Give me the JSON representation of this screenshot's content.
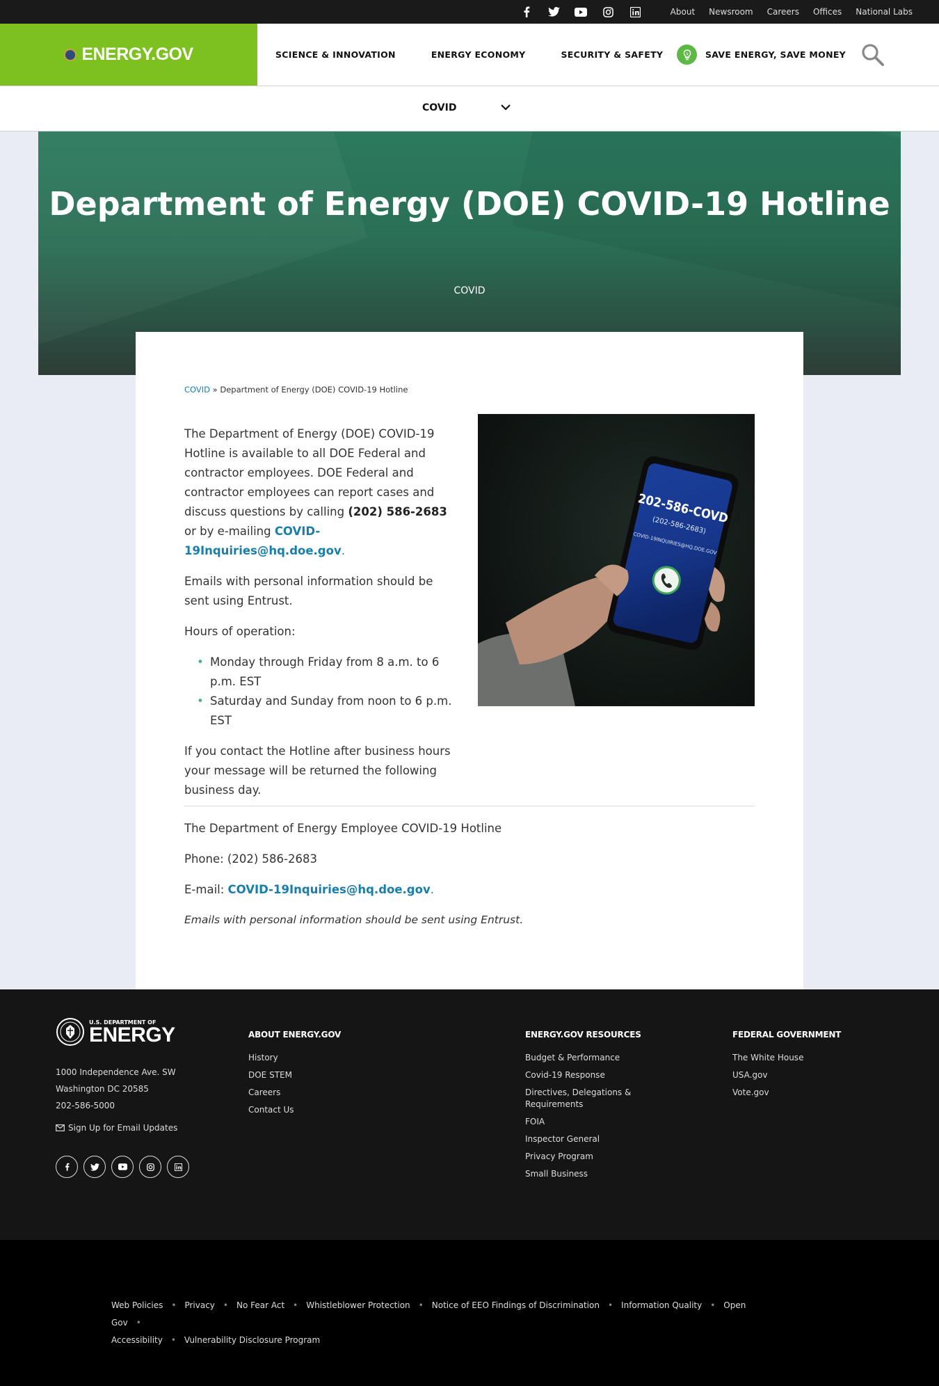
{
  "topbar": {
    "social": [
      "facebook-icon",
      "twitter-icon",
      "youtube-icon",
      "instagram-icon",
      "linkedin-icon"
    ],
    "links": [
      "About",
      "Newsroom",
      "Careers",
      "Offices",
      "National Labs"
    ]
  },
  "header": {
    "logo": "ENERGY.GOV",
    "nav": [
      "SCIENCE & INNOVATION",
      "ENERGY ECONOMY",
      "SECURITY & SAFETY"
    ],
    "save_label": "SAVE ENERGY, SAVE MONEY",
    "brand_color": "#7cc11f"
  },
  "subnav": {
    "label": "COVID"
  },
  "hero": {
    "title": "Department of Energy (DOE) COVID-19 Hotline",
    "tag": "COVID"
  },
  "breadcrumb": {
    "parent": "COVID",
    "separator": "»",
    "current": "Department of Energy (DOE) COVID-19 Hotline"
  },
  "content": {
    "p1_a": "The Department of Energy (DOE) COVID-19 Hotline is available to all DOE Federal and contractor employees.  DOE Federal and contractor employees can report cases and discuss questions by calling ",
    "p1_phone": "(202) 586-2683",
    "p1_b": " or by e-mailing ",
    "p1_email": "COVID-19Inquiries@hq.doe.gov",
    "p1_end": ".",
    "p2": "Emails with personal information should be sent using Entrust.",
    "p3": "Hours of operation:",
    "hours": [
      "Monday through Friday from 8 a.m. to 6 p.m. EST",
      "Saturday and Sunday from noon to 6 p.m. EST"
    ],
    "p4": "If you contact the Hotline after business hours your message will be returned the following business day.",
    "image": {
      "screen_number": "202-586-COVD",
      "screen_sub": "(202-586-2683)",
      "screen_email": "COVID-19INQUIRIES@HQ.DOE.GOV"
    }
  },
  "details": {
    "title": "The Department of Energy Employee COVID-19 Hotline",
    "phone": "Phone: (202) 586-2683",
    "email_label": "E-mail: ",
    "email": "COVID-19Inquiries@hq.doe.gov",
    "email_end": ".",
    "note": "Emails with personal information should be sent using Entrust."
  },
  "footer": {
    "logo_small": "U.S. DEPARTMENT OF",
    "logo_big": "ENERGY",
    "address": [
      "1000 Independence Ave. SW",
      "Washington DC 20585",
      "202-586-5000"
    ],
    "email_updates": "Sign Up for Email Updates",
    "columns": [
      {
        "title": "ABOUT ENERGY.GOV",
        "links": [
          "History",
          "DOE STEM",
          "Careers",
          "Contact Us"
        ]
      },
      {
        "title": "ENERGY.GOV RESOURCES",
        "links": [
          "Budget & Performance",
          "Covid-19 Response",
          "Directives, Delegations & Requirements",
          "FOIA",
          "Inspector General",
          "Privacy Program",
          "Small Business"
        ]
      },
      {
        "title": "FEDERAL GOVERNMENT",
        "links": [
          "The White House",
          "USA.gov",
          "Vote.gov"
        ]
      }
    ]
  },
  "bottom_links": [
    "Web Policies",
    "Privacy",
    "No Fear Act",
    "Whistleblower Protection",
    "Notice of EEO Findings of Discrimination",
    "Information Quality",
    "Open Gov",
    "Accessibility",
    "Vulnerability Disclosure Program"
  ]
}
